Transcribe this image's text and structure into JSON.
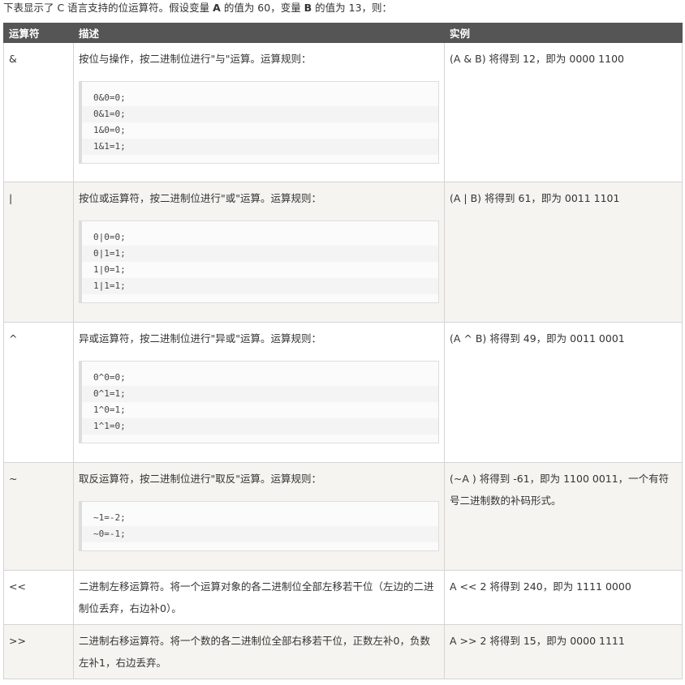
{
  "intro": {
    "prefix": "下表显示了 C 语言支持的位运算符。假设变量 ",
    "var_a": "A",
    "mid1": " 的值为 60，变量 ",
    "var_b": "B",
    "suffix": " 的值为 13，则："
  },
  "table": {
    "headers": [
      "运算符",
      "描述",
      "实例"
    ],
    "rows": [
      {
        "op": "&",
        "desc": "按位与操作，按二进制位进行\"与\"运算。运算规则：",
        "code": [
          "0&0=0;",
          "0&1=0;",
          "1&0=0;",
          "1&1=1;"
        ],
        "example": "(A & B) 将得到 12，即为 0000 1100"
      },
      {
        "op": "|",
        "desc": "按位或运算符，按二进制位进行\"或\"运算。运算规则：",
        "code": [
          "0|0=0;",
          "0|1=1;",
          "1|0=1;",
          "1|1=1;"
        ],
        "example": "(A | B) 将得到 61，即为 0011 1101"
      },
      {
        "op": "^",
        "desc": "异或运算符，按二进制位进行\"异或\"运算。运算规则：",
        "code": [
          "0^0=0;",
          "0^1=1;",
          "1^0=1;",
          "1^1=0;"
        ],
        "example": "(A ^ B) 将得到 49，即为 0011 0001"
      },
      {
        "op": "~",
        "desc": "取反运算符，按二进制位进行\"取反\"运算。运算规则：",
        "code": [
          "~1=-2;",
          "~0=-1;"
        ],
        "example": "(~A ) 将得到 -61，即为 1100 0011，一个有符号二进制数的补码形式。"
      },
      {
        "op": "<<",
        "desc": "二进制左移运算符。将一个运算对象的各二进制位全部左移若干位（左边的二进制位丢弃，右边补0）。",
        "code": [],
        "example": "A << 2 将得到 240，即为 1111 0000"
      },
      {
        "op": ">>",
        "desc": "二进制右移运算符。将一个数的各二进制位全部右移若干位，正数左补0，负数左补1，右边丢弃。",
        "code": [],
        "example": "A >> 2 将得到 15，即为 0000 1111"
      }
    ]
  }
}
